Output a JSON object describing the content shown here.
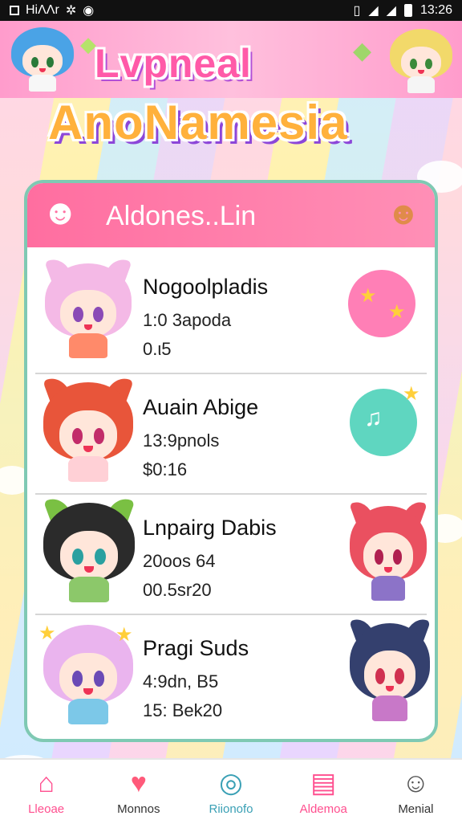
{
  "status_bar": {
    "left_text": "HiΛΛr",
    "time": "13:26"
  },
  "header": {
    "title_line1": "Lvpneal",
    "title_line2": "AnoNamesia"
  },
  "card": {
    "title": "Aldones..Lin",
    "items": [
      {
        "name": "Nogoolpladis",
        "sub": "1:0 3apoda",
        "price": "0.ι5"
      },
      {
        "name": "Auain Abige",
        "sub": "13:9pnols",
        "price": "$0:16"
      },
      {
        "name": "Lnpairg Dabis",
        "sub": "20oos 64",
        "price": "00.5sr20"
      },
      {
        "name": "Pragi Suds",
        "sub": "4:9dn, B5",
        "price": "15: Bek20"
      }
    ]
  },
  "nav": [
    {
      "label": "Lleoae",
      "icon": "home-icon",
      "color": "#ff4f8f"
    },
    {
      "label": "Monnos",
      "icon": "heart-icon",
      "color": "#333333"
    },
    {
      "label": "Riionofo",
      "icon": "search-icon",
      "color": "#3aa0b5"
    },
    {
      "label": "Aldemoa",
      "icon": "calendar-icon",
      "color": "#ff4f8f"
    },
    {
      "label": "Menial",
      "icon": "profile-icon",
      "color": "#333333"
    }
  ],
  "colors": {
    "accent": "#ff6ea0",
    "border": "#7fc9b3"
  }
}
